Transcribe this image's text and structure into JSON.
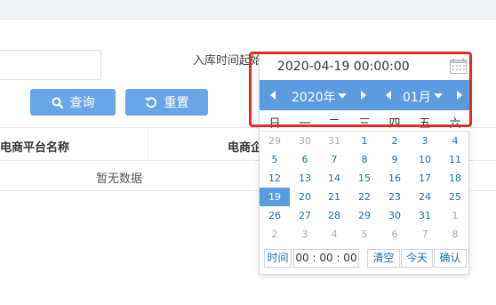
{
  "form": {
    "storage_time_label": "入库时间起始",
    "search_button": "查询",
    "reset_button": "重置"
  },
  "table": {
    "columns": [
      "电商平台名称",
      "电商企"
    ],
    "empty_text": "暂无数据"
  },
  "datepicker": {
    "input_value": "2020-04-19 00:00:00",
    "year": "2020年",
    "month": "01月",
    "weekdays": [
      "日",
      "一",
      "二",
      "三",
      "四",
      "五",
      "六"
    ],
    "weeks": [
      [
        "29",
        "30",
        "31",
        "1",
        "2",
        "3",
        "4"
      ],
      [
        "5",
        "6",
        "7",
        "8",
        "9",
        "10",
        "11"
      ],
      [
        "12",
        "13",
        "14",
        "15",
        "16",
        "17",
        "18"
      ],
      [
        "19",
        "20",
        "21",
        "22",
        "23",
        "24",
        "25"
      ],
      [
        "26",
        "27",
        "28",
        "29",
        "30",
        "31",
        "1"
      ],
      [
        "2",
        "3",
        "4",
        "5",
        "6",
        "7",
        "8"
      ]
    ],
    "time_label": "时间",
    "time_value": "00 : 00 : 00",
    "clear_button": "清空",
    "today_button": "今天",
    "confirm_button": "确认"
  },
  "colors": {
    "header_blue": "#5b9be0",
    "button_blue": "#6aa5e8",
    "day_text": "#1d6fa5",
    "highlight_red": "#e12b2b"
  }
}
